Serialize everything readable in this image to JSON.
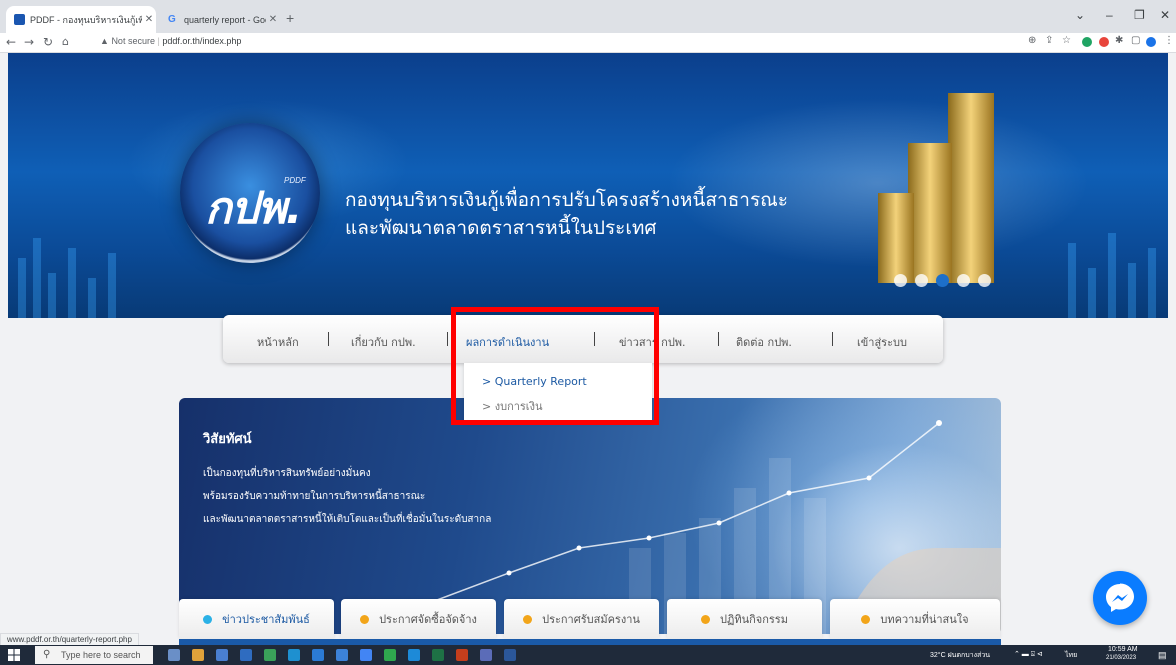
{
  "browser": {
    "tabs": [
      {
        "title": "PDDF - กองทุนบริหารเงินกู้เพื่อการปรับ",
        "active": true,
        "favicon_color": "#1a56b0"
      },
      {
        "title": "quarterly report - Google Search",
        "active": false,
        "favicon_color": "#4285f4"
      }
    ],
    "new_tab_label": "+",
    "window_controls": {
      "collapse": "⌄",
      "minimize": "–",
      "restore": "❐",
      "close": "✕"
    },
    "address": {
      "security": "Not secure",
      "url": "pddf.or.th/index.php"
    },
    "status_bar_url": "www.pddf.or.th/quarterly-report.php"
  },
  "site": {
    "logo_text": "กปพ.",
    "logo_small": "PDDF",
    "org_name_line1": "กองทุนบริหารเงินกู้เพื่อการปรับโครงสร้างหนี้สาธารณะ",
    "org_name_line2": "และพัฒนาตลาดตราสารหนี้ในประเทศ",
    "menu": [
      {
        "label": "หน้าหลัก",
        "active": false
      },
      {
        "label": "เกี่ยวกับ กปพ.",
        "active": false
      },
      {
        "label": "ผลการดำเนินงาน",
        "active": true
      },
      {
        "label": "ข่าวสาร กปพ.",
        "active": false
      },
      {
        "label": "ติดต่อ กปพ.",
        "active": false
      },
      {
        "label": "เข้าสู่ระบบ",
        "active": false
      }
    ],
    "dropdown": [
      {
        "label": "> Quarterly Report",
        "color": "#1d5aa3"
      },
      {
        "label": "> งบการเงิน",
        "color": "#777777"
      }
    ],
    "hero": {
      "title": "วิสัยทัศน์",
      "lines": [
        "เป็นกองทุนที่บริหารสินทรัพย์อย่างมั่นคง",
        "พร้อมรองรับความท้าทายในการบริหารหนี้สาธารณะ",
        "และพัฒนาตลาดตราสารหนี้ให้เติบโตและเป็นที่เชื่อมั่นในระดับสากล"
      ]
    },
    "bottom_tabs": [
      {
        "label": "ข่าวประชาสัมพันธ์"
      },
      {
        "label": "ประกาศจัดซื้อจัดจ้าง"
      },
      {
        "label": "ประกาศรับสมัครงาน"
      },
      {
        "label": "ปฏิทินกิจกรรม"
      },
      {
        "label": "บทความที่น่าสนใจ"
      }
    ]
  },
  "taskbar": {
    "search_placeholder": "Type here to search",
    "weather": "32°C ฝนตกบางส่วน",
    "language": "ไทย",
    "time": "10:59 AM",
    "date": "21/03/2023"
  },
  "colors": {
    "highlight": "#ff0000",
    "accent": "#1d5aa3",
    "messenger": "#0a7cff"
  }
}
